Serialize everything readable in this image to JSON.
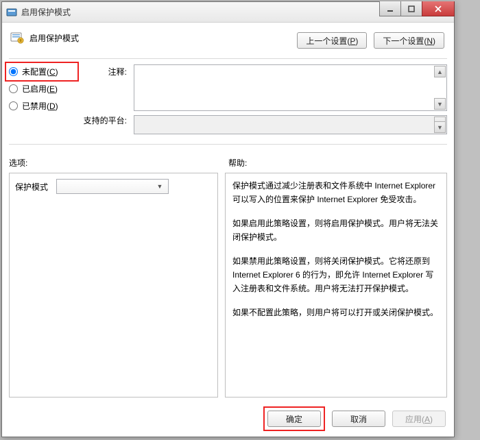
{
  "window": {
    "title": "启用保护模式"
  },
  "header": {
    "heading": "启用保护模式"
  },
  "nav": {
    "prev_label": "上一个设置(",
    "prev_accel": "P",
    "prev_label_end": ")",
    "next_label": "下一个设置(",
    "next_accel": "N",
    "next_label_end": ")"
  },
  "radios": {
    "not_configured": "未配置(",
    "not_configured_accel": "C",
    "not_configured_end": ")",
    "enabled": "已启用(",
    "enabled_accel": "E",
    "enabled_end": ")",
    "disabled": "已禁用(",
    "disabled_accel": "D",
    "disabled_end": ")"
  },
  "labels": {
    "comment": "注释:",
    "platforms": "支持的平台:",
    "options": "选项:",
    "help": "帮助:"
  },
  "options": {
    "item_label": "保护模式",
    "select_value": ""
  },
  "help": {
    "p1": "保护模式通过减少注册表和文件系统中 Internet Explorer 可以写入的位置来保护 Internet Explorer 免受攻击。",
    "p2": "如果启用此策略设置，则将启用保护模式。用户将无法关闭保护模式。",
    "p3": "如果禁用此策略设置，则将关闭保护模式。它将还原到 Internet Explorer 6 的行为，即允许 Internet Explorer 写入注册表和文件系统。用户将无法打开保护模式。",
    "p4": "如果不配置此策略，则用户将可以打开或关闭保护模式。"
  },
  "footer": {
    "ok": "确定",
    "cancel": "取消",
    "apply": "应用(",
    "apply_accel": "A",
    "apply_end": ")"
  }
}
